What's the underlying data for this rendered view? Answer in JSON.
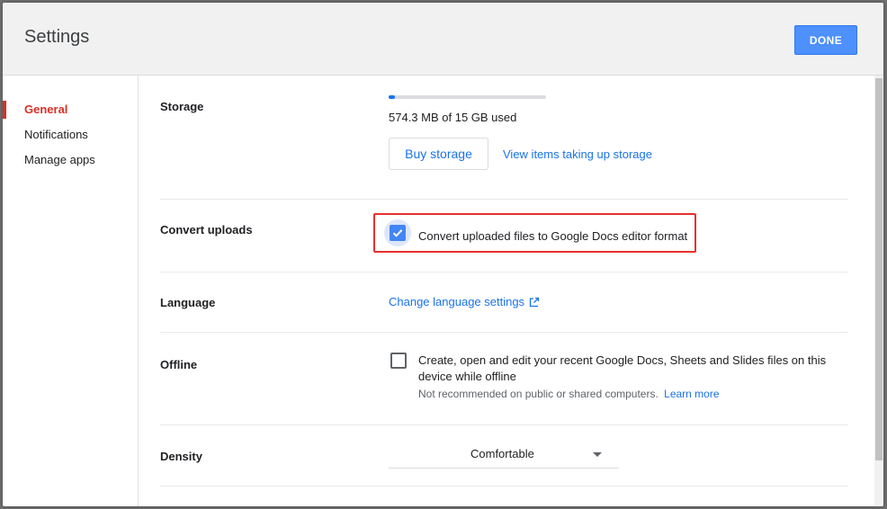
{
  "dialog": {
    "title": "Settings",
    "done_label": "DONE"
  },
  "sidebar": {
    "items": [
      {
        "label": "General",
        "active": true
      },
      {
        "label": "Notifications",
        "active": false
      },
      {
        "label": "Manage apps",
        "active": false
      }
    ]
  },
  "storage": {
    "label": "Storage",
    "used_text": "574.3 MB of 15 GB used",
    "used_fraction": 0.0374,
    "buy_label": "Buy storage",
    "view_items_label": "View items taking up storage"
  },
  "convert": {
    "label": "Convert uploads",
    "checked": true,
    "option_text": "Convert uploaded files to Google Docs editor format"
  },
  "language": {
    "label": "Language",
    "link_text": "Change language settings",
    "icon": "open-in-new-icon"
  },
  "offline": {
    "label": "Offline",
    "checked": false,
    "option_text_line1": "Create, open and edit your recent Google Docs, Sheets and Slides files on this",
    "option_text_line2": "device while offline",
    "note_text": "Not recommended on public or shared computers.",
    "learn_more": "Learn more"
  },
  "density": {
    "label": "Density",
    "selected": "Comfortable",
    "icon": "dropdown-arrow-icon"
  },
  "colors": {
    "accent": "#1a73e8",
    "done_button": "#4d90fe",
    "active_nav": "#d93025",
    "highlight": "#e8302f"
  }
}
